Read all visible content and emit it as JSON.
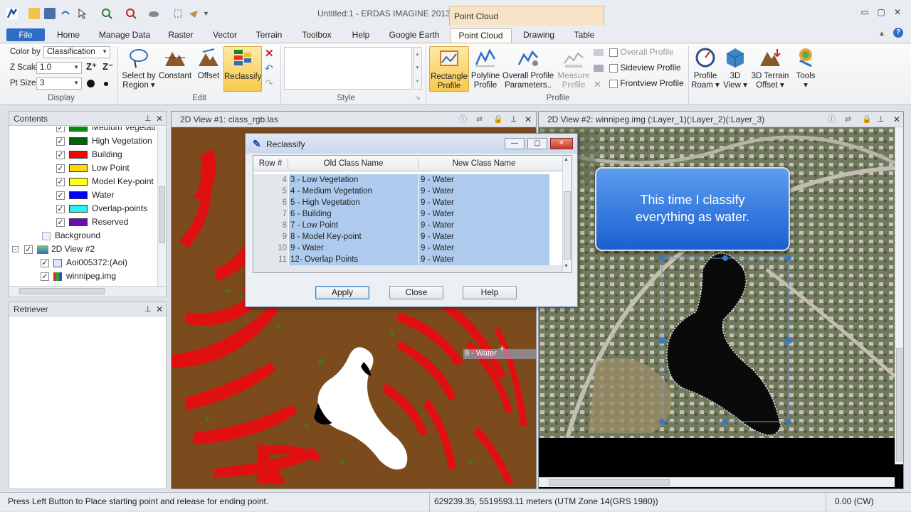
{
  "app": {
    "title": "Untitled:1 - ERDAS IMAGINE 2013",
    "context_tab": "Point Cloud",
    "win_min": "▭",
    "win_max": "▢",
    "win_close": "✕"
  },
  "menu": [
    "File",
    "Home",
    "Manage Data",
    "Raster",
    "Vector",
    "Terrain",
    "Toolbox",
    "Help",
    "Google Earth",
    "Point Cloud",
    "Drawing",
    "Table"
  ],
  "ribbon": {
    "display": {
      "color_by_label": "Color by",
      "color_by_value": "Classification",
      "zscale_label": "Z Scale",
      "zscale_value": "1.0",
      "ptsize_label": "Pt Size",
      "ptsize_value": "3",
      "title": "Display"
    },
    "edit": {
      "select_by": "Select by",
      "region": "Region",
      "constant": "Constant",
      "offset": "Offset",
      "reclassify": "Reclassify",
      "title": "Edit"
    },
    "style": {
      "title": "Style"
    },
    "profile": {
      "rect1": "Rectangle",
      "rect2": "Profile",
      "poly1": "Polyline",
      "poly2": "Profile",
      "overall1": "Overall Profile",
      "overall2": "Parameters..",
      "measure1": "Measure",
      "measure2": "Profile",
      "overall_profile": "Overall Profile",
      "sideview_profile": "Sideview Profile",
      "frontview_profile": "Frontview Profile",
      "title": "Profile"
    },
    "right": {
      "pr1": "Profile",
      "pr2": "Roam",
      "v1": "3D",
      "v2": "View",
      "t1": "3D Terrain",
      "t2": "Offset",
      "tools": "Tools"
    }
  },
  "contents": {
    "title": "Contents",
    "items": [
      {
        "label": "Medium Vegetation",
        "color": "#0a8a0a"
      },
      {
        "label": "High Vegetation",
        "color": "#00640a"
      },
      {
        "label": "Building",
        "color": "#ff0000"
      },
      {
        "label": "Low Point",
        "color": "#ffd800"
      },
      {
        "label": "Model Key-point",
        "color": "#ffff1e"
      },
      {
        "label": "Water",
        "color": "#0000ff"
      },
      {
        "label": "Overlap-points",
        "color": "#27f0f0"
      },
      {
        "label": "Reserved",
        "color": "#6e0ab4"
      }
    ],
    "background": "Background",
    "view2": "2D View #2",
    "aoi": "Aoi005372:(Aoi)",
    "img": "winnipeg.img"
  },
  "retriever": {
    "title": "Retriever"
  },
  "view1": {
    "title": "2D View #1: class_rgb.las",
    "drag_label": "9 - Water"
  },
  "view2": {
    "title": "2D View #2: winnipeg.img (:Layer_1)(:Layer_2)(:Layer_3)",
    "callout": "This time I classify everything as water."
  },
  "dialog": {
    "title": "Reclassify",
    "headers": [
      "Row #",
      "Old Class Name",
      "New Class Name"
    ],
    "rows": [
      {
        "row": "4",
        "old": "3 - Low Vegetation",
        "new": "9 - Water"
      },
      {
        "row": "5",
        "old": "4 - Medium Vegetation",
        "new": "9 - Water"
      },
      {
        "row": "6",
        "old": "5 - High Vegetation",
        "new": "9 - Water"
      },
      {
        "row": "7",
        "old": "6 - Building",
        "new": "9 - Water"
      },
      {
        "row": "8",
        "old": "7 - Low Point",
        "new": "9 - Water"
      },
      {
        "row": "9",
        "old": "8 - Model Key-point",
        "new": "9 - Water"
      },
      {
        "row": "10",
        "old": "9 - Water",
        "new": "9 - Water"
      },
      {
        "row": "11",
        "old": "12- Overlap Points",
        "new": "9 - Water"
      }
    ],
    "apply": "Apply",
    "close": "Close",
    "help": "Help"
  },
  "status": {
    "message": "Press Left Button to Place starting point and release for ending point.",
    "coords": "629239.35, 5519593.11 meters (UTM Zone 14(GRS 1980))",
    "rotation": "0.00 (CW)"
  }
}
